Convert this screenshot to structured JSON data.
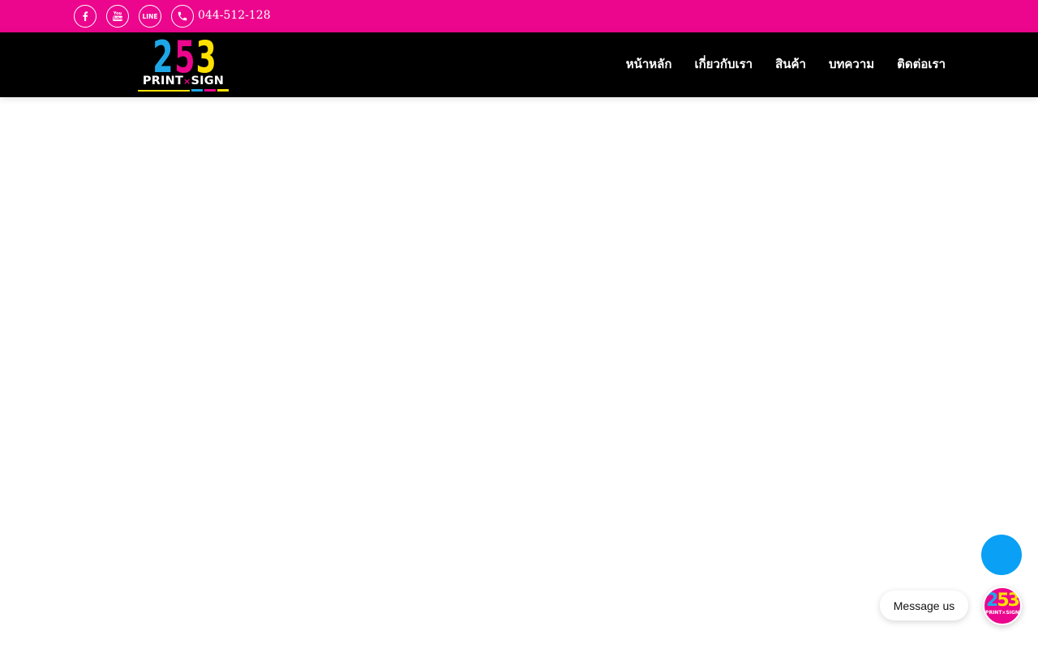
{
  "topbar": {
    "phone": "044-512-128",
    "social_icons": [
      "facebook-icon",
      "youtube-icon",
      "line-icon",
      "phone-icon"
    ],
    "colors": {
      "background": "#ec068d",
      "foreground": "#ffffff"
    }
  },
  "logo": {
    "digits": [
      "2",
      "5",
      "3"
    ],
    "wordmark_left": "PRINT",
    "wordmark_sep": "×",
    "wordmark_right": "SIGN",
    "colors": {
      "cyan": "#1ea7e8",
      "magenta": "#ec068d",
      "yellow": "#ffe100"
    }
  },
  "nav": {
    "items": [
      {
        "label": "หน้าหลัก"
      },
      {
        "label": "เกี่ยวกับเรา"
      },
      {
        "label": "สินค้า"
      },
      {
        "label": "บทความ"
      },
      {
        "label": "ติดต่อเรา"
      }
    ],
    "colors": {
      "background": "#000000",
      "text": "#ffffff"
    }
  },
  "floating": {
    "button_color": "#0aa0f5",
    "messenger_label": "Message us",
    "avatar": {
      "digits": [
        "2",
        "5",
        "3"
      ],
      "wordmark": "PRINT×SIGN"
    }
  }
}
